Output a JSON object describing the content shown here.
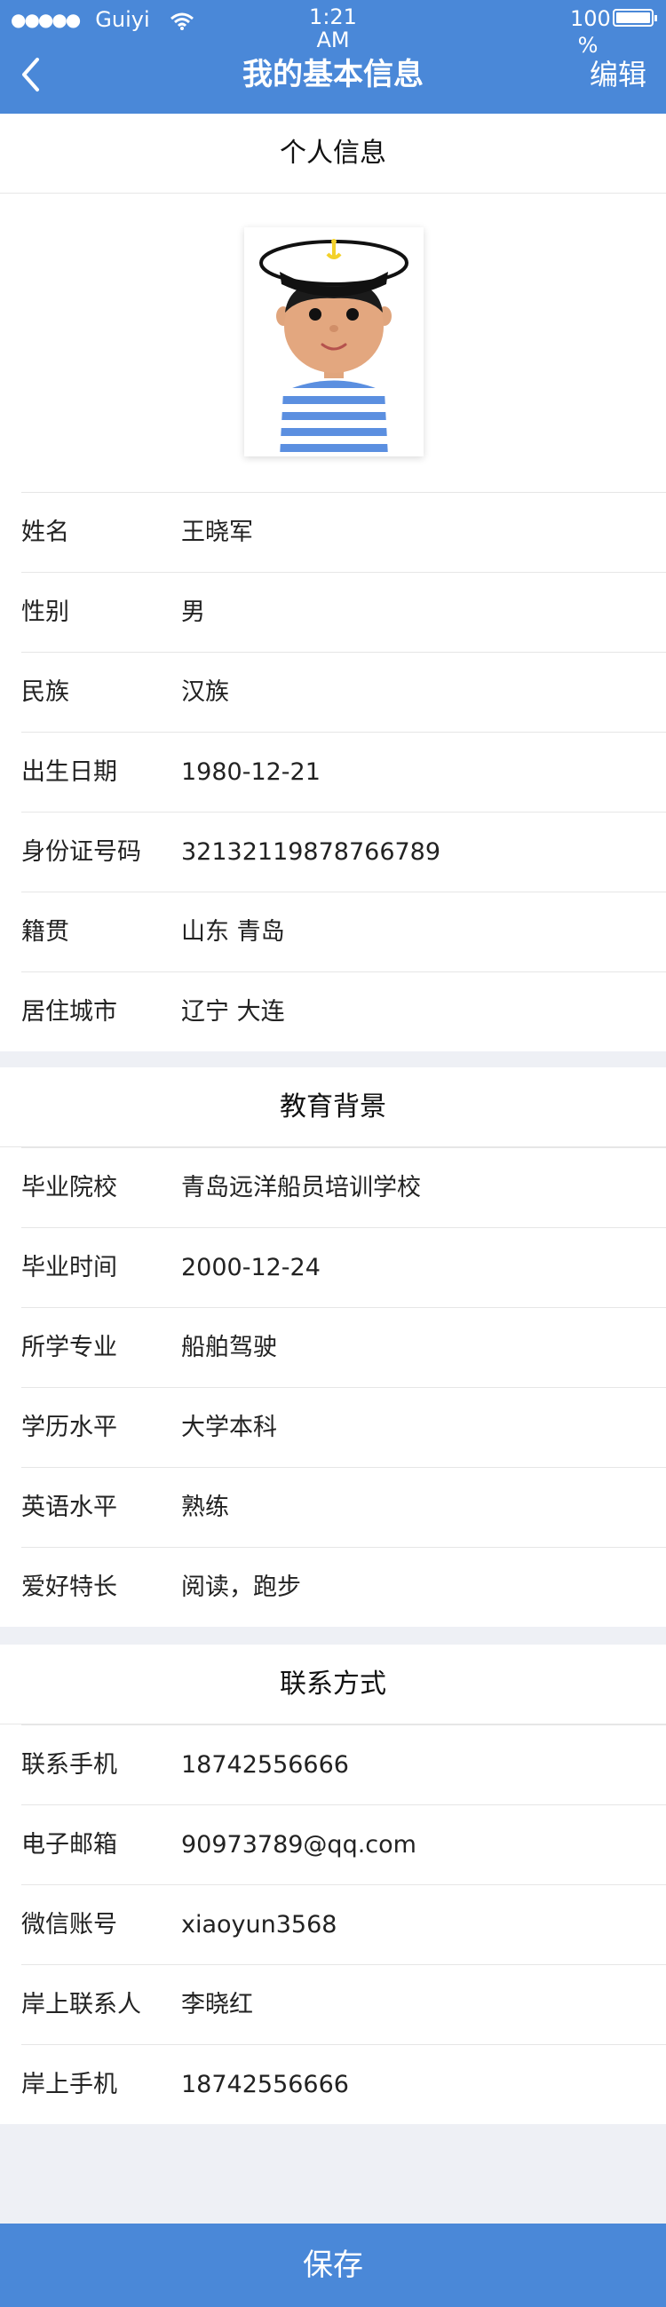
{
  "status_bar": {
    "signal_dots": "●●●●●",
    "carrier": "Guiyi",
    "time_line1": "1:21",
    "time_line2": "AM",
    "battery_line1": "100",
    "battery_line2": "%"
  },
  "header": {
    "title": "我的基本信息",
    "edit_label": "编辑"
  },
  "personal": {
    "title": "个人信息",
    "rows": [
      {
        "label": "姓名",
        "value": "王晓军"
      },
      {
        "label": "性别",
        "value": "男"
      },
      {
        "label": "民族",
        "value": "汉族"
      },
      {
        "label": "出生日期",
        "value": "1980-12-21"
      },
      {
        "label": "身份证号码",
        "value": "32132119878766789"
      },
      {
        "label": "籍贯",
        "value": "山东 青岛"
      },
      {
        "label": "居住城市",
        "value": "辽宁 大连"
      }
    ]
  },
  "education": {
    "title": "教育背景",
    "rows": [
      {
        "label": "毕业院校",
        "value": "青岛远洋船员培训学校"
      },
      {
        "label": "毕业时间",
        "value": "2000-12-24"
      },
      {
        "label": "所学专业",
        "value": "船舶驾驶"
      },
      {
        "label": "学历水平",
        "value": "大学本科"
      },
      {
        "label": "英语水平",
        "value": "熟练"
      },
      {
        "label": "爱好特长",
        "value": "阅读，跑步"
      }
    ]
  },
  "contact": {
    "title": "联系方式",
    "rows": [
      {
        "label": "联系手机",
        "value": "18742556666"
      },
      {
        "label": "电子邮箱",
        "value": "90973789@qq.com"
      },
      {
        "label": "微信账号",
        "value": "xiaoyun3568"
      },
      {
        "label": "岸上联系人",
        "value": "李晓红"
      },
      {
        "label": "岸上手机",
        "value": "18742556666"
      }
    ]
  },
  "footer": {
    "save_label": "保存"
  },
  "colors": {
    "accent": "#4a88d8",
    "page_bg": "#eef0f5"
  }
}
